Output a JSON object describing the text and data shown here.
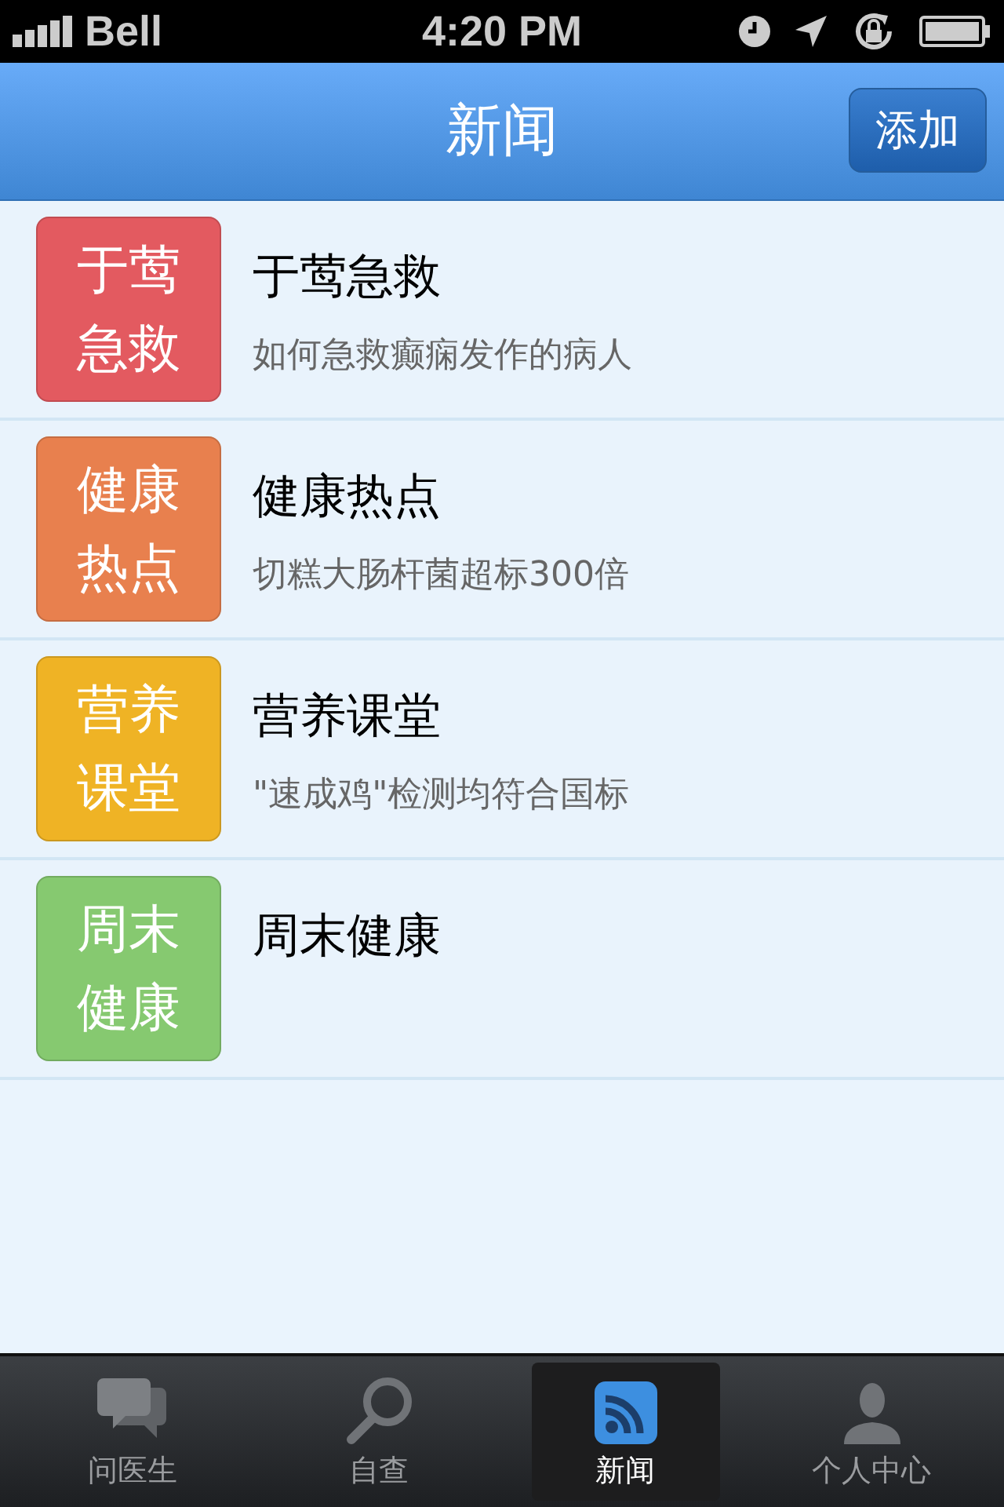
{
  "status_bar": {
    "carrier": "Bell",
    "time": "4:20 PM"
  },
  "nav_bar": {
    "title": "新闻",
    "button": "添加"
  },
  "items": [
    {
      "tile": "于莺急救",
      "color": "#e35a60",
      "title": "于莺急救",
      "subtitle": "如何急救癫痫发作的病人"
    },
    {
      "tile": "健康热点",
      "color": "#e8804e",
      "title": "健康热点",
      "subtitle": "切糕大肠杆菌超标300倍"
    },
    {
      "tile": "营养课堂",
      "color": "#efb325",
      "title": "营养课堂",
      "subtitle": "\"速成鸡\"检测均符合国标"
    },
    {
      "tile": "周末健康",
      "color": "#86c970",
      "title": "周末健康"
    }
  ],
  "tab_bar": [
    {
      "label": "问医生",
      "selected": false
    },
    {
      "label": "自查",
      "selected": false
    },
    {
      "label": "新闻",
      "selected": true
    },
    {
      "label": "个人中心",
      "selected": false
    }
  ]
}
